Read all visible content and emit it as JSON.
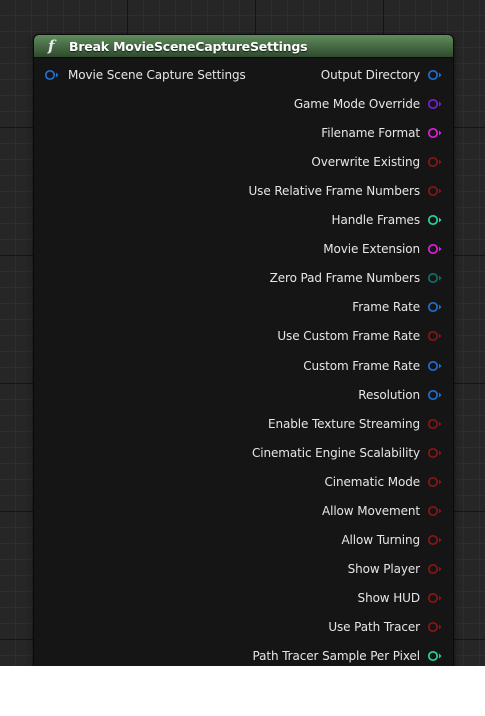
{
  "node": {
    "title": "Break MovieSceneCaptureSettings",
    "header_color": "#496e47",
    "icon": "function-icon",
    "icon_glyph": "f",
    "input": {
      "label": "Movie Scene Capture Settings",
      "color": "#1f6fd6",
      "icon": "struct-pin-icon"
    },
    "outputs": [
      {
        "label": "Output Directory",
        "color": "#1f6fd6",
        "pin": "struct-pin-icon"
      },
      {
        "label": "Game Mode Override",
        "color": "#7a1fd6",
        "pin": "class-pin-icon"
      },
      {
        "label": "Filename Format",
        "color": "#e21ce0",
        "pin": "string-pin-icon"
      },
      {
        "label": "Overwrite Existing",
        "color": "#8c1414",
        "pin": "bool-pin-icon"
      },
      {
        "label": "Use Relative Frame Numbers",
        "color": "#8c1414",
        "pin": "bool-pin-icon"
      },
      {
        "label": "Handle Frames",
        "color": "#22d6a4",
        "pin": "int-pin-icon"
      },
      {
        "label": "Movie Extension",
        "color": "#e21ce0",
        "pin": "string-pin-icon"
      },
      {
        "label": "Zero Pad Frame Numbers",
        "color": "#0e7068",
        "pin": "byte-pin-icon"
      },
      {
        "label": "Frame Rate",
        "color": "#1f6fd6",
        "pin": "struct-pin-icon"
      },
      {
        "label": "Use Custom Frame Rate",
        "color": "#8c1414",
        "pin": "bool-pin-icon"
      },
      {
        "label": "Custom Frame Rate",
        "color": "#1f6fd6",
        "pin": "struct-pin-icon"
      },
      {
        "label": "Resolution",
        "color": "#1f6fd6",
        "pin": "struct-pin-icon"
      },
      {
        "label": "Enable Texture Streaming",
        "color": "#8c1414",
        "pin": "bool-pin-icon"
      },
      {
        "label": "Cinematic Engine Scalability",
        "color": "#8c1414",
        "pin": "bool-pin-icon"
      },
      {
        "label": "Cinematic Mode",
        "color": "#8c1414",
        "pin": "bool-pin-icon"
      },
      {
        "label": "Allow Movement",
        "color": "#8c1414",
        "pin": "bool-pin-icon"
      },
      {
        "label": "Allow Turning",
        "color": "#8c1414",
        "pin": "bool-pin-icon"
      },
      {
        "label": "Show Player",
        "color": "#8c1414",
        "pin": "bool-pin-icon"
      },
      {
        "label": "Show HUD",
        "color": "#8c1414",
        "pin": "bool-pin-icon"
      },
      {
        "label": "Use Path Tracer",
        "color": "#8c1414",
        "pin": "bool-pin-icon"
      },
      {
        "label": "Path Tracer Sample Per Pixel",
        "color": "#22d6a4",
        "pin": "int-pin-icon"
      }
    ]
  }
}
